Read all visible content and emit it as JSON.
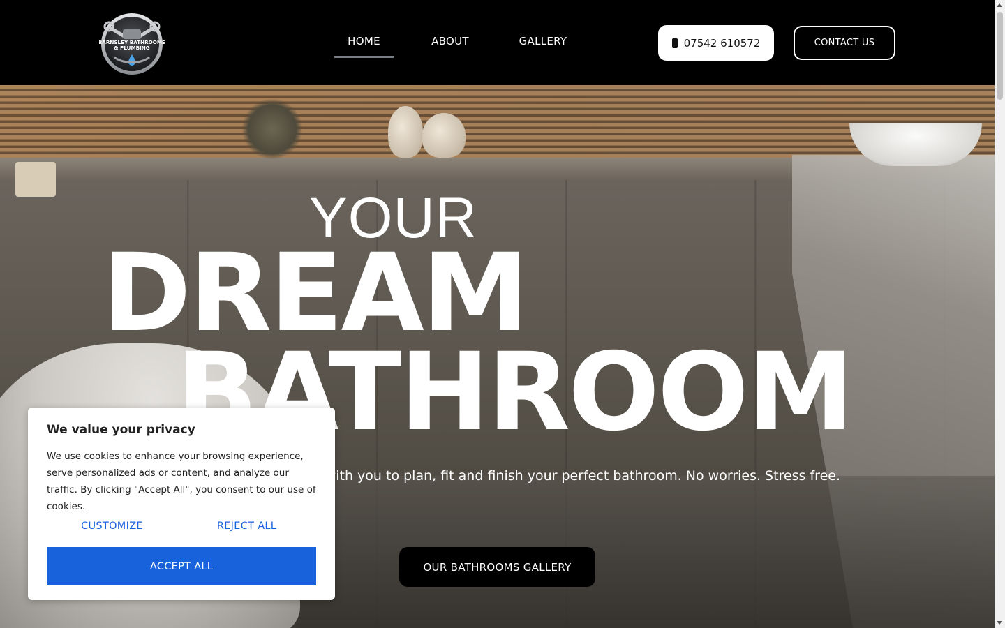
{
  "header": {
    "logo": {
      "text_line1": "BARNSLEY BATHROOMS",
      "text_line2": "& PLUMBING",
      "icon": "wrench-logo-icon"
    },
    "nav": [
      {
        "label": "HOME",
        "active": true
      },
      {
        "label": "ABOUT",
        "active": false
      },
      {
        "label": "GALLERY",
        "active": false
      }
    ],
    "phone": {
      "label": "07542 610572",
      "icon": "mobile-phone-icon"
    },
    "contact_label": "CONTACT US"
  },
  "hero": {
    "line1": "YOUR",
    "line2": "DREAM",
    "line3": "BATHROOM",
    "subtitle": "ng with you to plan, fit and finish your perfect bathroom. No worries. Stress free.",
    "button_label": "OUR BATHROOMS GALLERY"
  },
  "cookie_banner": {
    "title": "We value your privacy",
    "text": "We use cookies to enhance your browsing experience, serve personalized ads or content, and analyze our traffic. By clicking \"Accept All\", you consent to our use of cookies.",
    "customize_label": "CUSTOMIZE",
    "reject_label": "REJECT ALL",
    "accept_label": "ACCEPT ALL",
    "accent_color": "#1863dc"
  },
  "colors": {
    "header_bg": "#000000",
    "nav_active_underline": "#7a7f86",
    "button_dark": "#000000"
  }
}
